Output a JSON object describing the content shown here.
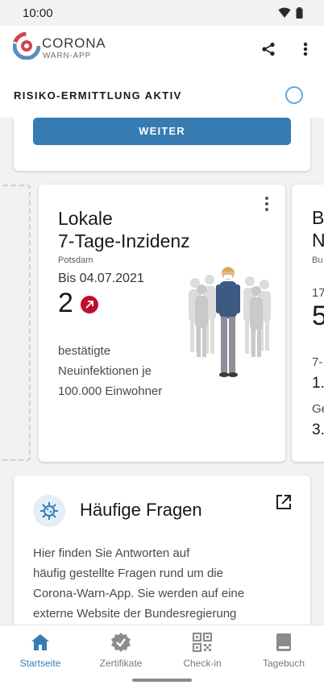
{
  "status_bar": {
    "time": "10:00"
  },
  "app_bar": {
    "brand_line1": "CORONA",
    "brand_line2": "WARN-APP"
  },
  "risk": {
    "title": "RISIKO-ERMITTLUNG AKTIV"
  },
  "top_card": {
    "button_label": "WEITER"
  },
  "incidence_card": {
    "title_line1": "Lokale",
    "title_line2": "7-Tage-Inzidenz",
    "region": "Potsdam",
    "date": "Bis 04.07.2021",
    "value": "2",
    "desc_line1": "bestätigte",
    "desc_line2": "Neuinfektionen je",
    "desc_line3": "100.000 Einwohner"
  },
  "next_card": {
    "line1": "B",
    "line2": "N",
    "small": "Bu",
    "val_small": "17",
    "big": "5",
    "label2": "7-",
    "val2": "1.",
    "label3": "Ge",
    "val3": "3."
  },
  "faq": {
    "title": "Häufige Fragen",
    "line1": "Hier finden Sie Antworten auf",
    "line2": "häufig gestellte Fragen rund um die",
    "line3": "Corona-Warn-App. Sie werden auf eine",
    "line4": "externe Website der Bundesregierung"
  },
  "bottom_nav": {
    "items": [
      {
        "label": "Startseite",
        "icon": "home-icon",
        "active": true
      },
      {
        "label": "Zertifikate",
        "icon": "certificate-icon",
        "active": false
      },
      {
        "label": "Check-in",
        "icon": "qr-code-icon",
        "active": false
      },
      {
        "label": "Tagebuch",
        "icon": "book-icon",
        "active": false
      }
    ]
  },
  "colors": {
    "accent": "#367cb2",
    "trend_up": "#c00f2d",
    "background": "#f2f2f2"
  }
}
